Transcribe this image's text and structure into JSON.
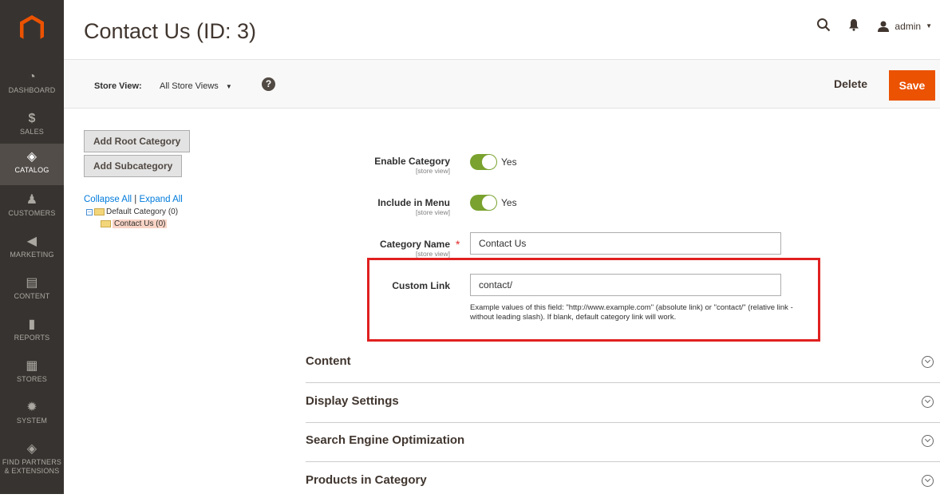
{
  "sidebar": {
    "items": [
      {
        "label": "DASHBOARD",
        "icon": "dashboard-icon",
        "glyph": "◔"
      },
      {
        "label": "SALES",
        "icon": "dollar-icon",
        "glyph": "$"
      },
      {
        "label": "CATALOG",
        "icon": "cube-icon",
        "glyph": "◈"
      },
      {
        "label": "CUSTOMERS",
        "icon": "person-icon",
        "glyph": "♟"
      },
      {
        "label": "MARKETING",
        "icon": "megaphone-icon",
        "glyph": "◀"
      },
      {
        "label": "CONTENT",
        "icon": "layout-icon",
        "glyph": "▤"
      },
      {
        "label": "REPORTS",
        "icon": "bar-chart-icon",
        "glyph": "▮"
      },
      {
        "label": "STORES",
        "icon": "storefront-icon",
        "glyph": "▦"
      },
      {
        "label": "SYSTEM",
        "icon": "gear-icon",
        "glyph": "✹"
      },
      {
        "label": "FIND PARTNERS & EXTENSIONS",
        "icon": "box-icon",
        "glyph": "◈"
      }
    ],
    "active_index": 2
  },
  "header": {
    "title": "Contact Us (ID: 3)",
    "user": "admin"
  },
  "toolbar": {
    "store_view_label": "Store View:",
    "store_view_value": "All Store Views",
    "help_glyph": "?",
    "delete_label": "Delete",
    "save_label": "Save"
  },
  "tree": {
    "add_root_label": "Add Root Category",
    "add_sub_label": "Add Subcategory",
    "collapse_all": "Collapse All",
    "separator": "|",
    "expand_all": "Expand All",
    "root_node": "Default Category (0)",
    "child_node": "Contact Us (0)"
  },
  "form": {
    "enable_category": {
      "label": "Enable Category",
      "scope": "[store view]",
      "value": "Yes"
    },
    "include_in_menu": {
      "label": "Include in Menu",
      "scope": "[store view]",
      "value": "Yes"
    },
    "category_name": {
      "label": "Category Name",
      "scope": "[store view]",
      "value": "Contact Us",
      "required_mark": "*"
    },
    "custom_link": {
      "label": "Custom Link",
      "value": "contact/",
      "note": "Example values of this field: \"http://www.example.com\" (absolute link) or \"contact/\" (relative link - without leading slash). If blank, default category link will work."
    }
  },
  "sections": [
    "Content",
    "Display Settings",
    "Search Engine Optimization",
    "Products in Category"
  ],
  "colors": {
    "accent": "#eb5202",
    "sidebar": "#373330",
    "toggle_on": "#79a22e",
    "highlight": "#e02020"
  }
}
